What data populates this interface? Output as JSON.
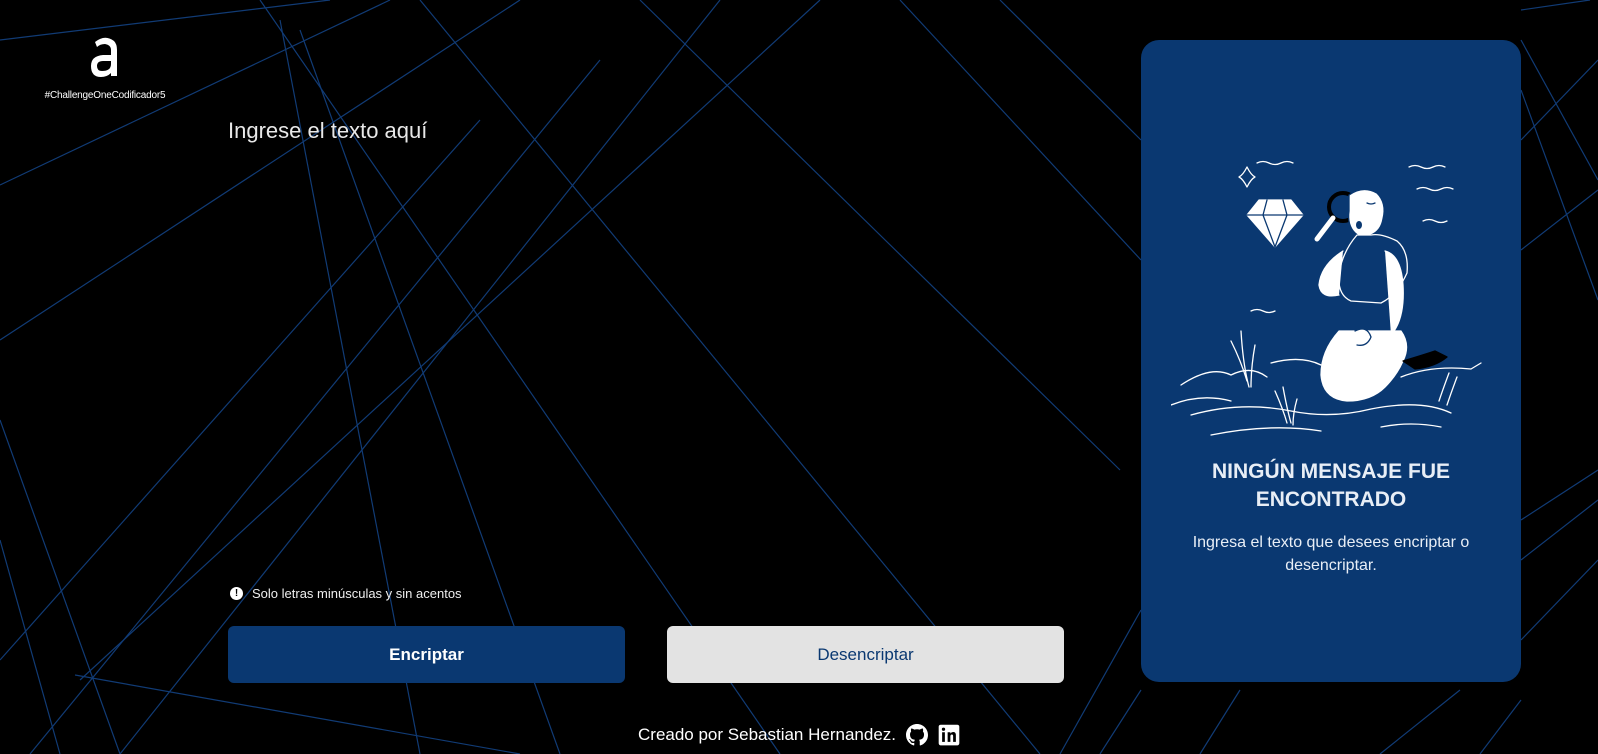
{
  "header": {
    "logo_icon": "alura-logo-icon",
    "hashtag": "#ChallengeOneCodificador5"
  },
  "main": {
    "input_placeholder": "Ingrese el texto aquí",
    "input_value": "",
    "hint_icon": "exclamation-circle-icon",
    "hint_text": "Solo letras minúsculas y sin acentos",
    "encrypt_label": "Encriptar",
    "decrypt_label": "Desencriptar"
  },
  "result_panel": {
    "title": "NINGÚN MENSAJE FUE ENCONTRADO",
    "description": "Ingresa el texto que desees encriptar o desencriptar.",
    "illustration": "person-with-magnifying-glass-and-diamond-illustration"
  },
  "footer": {
    "credit": "Creado por Sebastian Hernandez.",
    "github_icon": "github-icon",
    "linkedin_icon": "linkedin-icon"
  },
  "colors": {
    "background": "#000000",
    "primary": "#0a3871",
    "secondary_button": "#e3e3e3",
    "line_pattern": "#123f7c"
  }
}
